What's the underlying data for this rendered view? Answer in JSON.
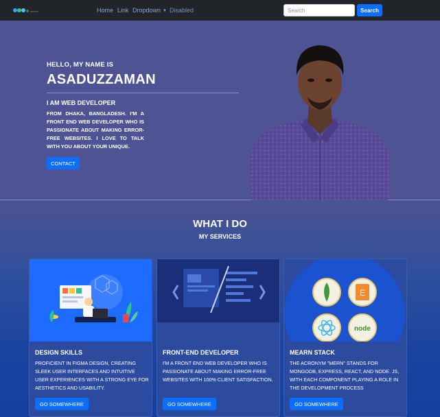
{
  "nav": {
    "links": [
      "Home",
      "Link",
      "Dropdown",
      "Disabled"
    ],
    "search_placeholder": "Search",
    "search_button": "Search"
  },
  "hero": {
    "greeting": "HELLO, MY NAME IS",
    "name": "ASADUZZAMAN",
    "role": "I AM WEB DEVELOPER",
    "bio": "FROM DHAKA, BANGLADESH. I'M A FRONT END WEB DEVELOPER WHO IS PASSIONATE ABOUT MAKING ERROR-FREE WEBSITES. I LOVE TO TALK WITH YOU ABOUT YOUR UNIQUE.",
    "contact_button": "CONTACT"
  },
  "services": {
    "title": "WHAT I DO",
    "subtitle": "MY SERVICES",
    "cards": [
      {
        "title": "DESIGN SKILLS",
        "text": "PROFICIENT IN FIGMA DESIGN, CREATING SLEEK USER INTERFACES AND INTUITIVE USER EXPERIENCES WITH A STRONG EYE FOR AESTHETICS AND USABILITY.",
        "button": "GO SOMEWHERE"
      },
      {
        "title": "FRONT-END DEVELOPER",
        "text": "I'M A FRONT END WEB DEVELOPER WHO IS PASSIONATE ABOUT MAKING ERROR-FREE WEBSITES WITH 100% CLIENT SATISFACTION.",
        "button": "GO SOMEWHERE"
      },
      {
        "title": "MEARN STACK",
        "text": "THE ACRONYM \"MERN\" STANDS FOR MONGODB, EXPRESS, REACT, AND NODE. JS, WITH EACH COMPONENT PLAYING A ROLE IN THE DEVELOPMENT PROCESS",
        "button": "GO SOMEWHERE"
      }
    ],
    "tech_logos": [
      "E",
      "node"
    ]
  },
  "colors": {
    "navbar": "#212529",
    "hero_bg": "#4e5393",
    "accent": "#0d6efd",
    "services_bottom": "#1340a0"
  }
}
